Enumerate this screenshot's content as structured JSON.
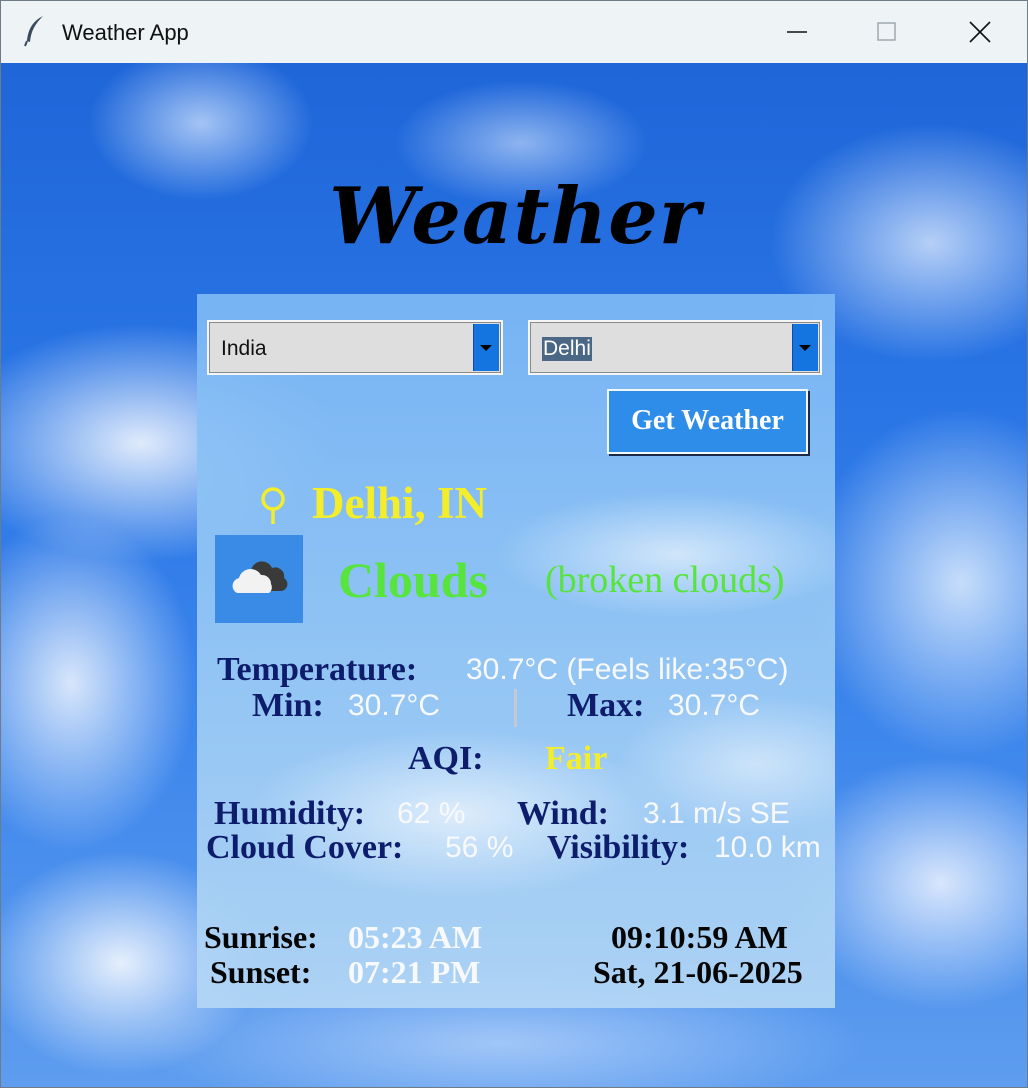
{
  "window": {
    "title": "Weather App"
  },
  "app": {
    "heading": "Weather",
    "country_select": {
      "value": "India"
    },
    "city_select": {
      "value": "Delhi"
    },
    "get_weather_label": "Get Weather",
    "location": "Delhi, IN",
    "weather": {
      "main": "Clouds",
      "description": "(broken clouds)",
      "icon": "broken-clouds-icon"
    },
    "temperature": {
      "label": "Temperature:",
      "value": "30.7°C (Feels like:35°C)"
    },
    "min": {
      "label": "Min:",
      "value": "30.7°C"
    },
    "max": {
      "label": "Max:",
      "value": "30.7°C"
    },
    "aqi": {
      "label": "AQI:",
      "value": "Fair"
    },
    "humidity": {
      "label": "Humidity:",
      "value": "62 %"
    },
    "wind": {
      "label": "Wind:",
      "value": "3.1 m/s SE"
    },
    "cloud_cover": {
      "label": "Cloud Cover:",
      "value": "56 %"
    },
    "visibility": {
      "label": "Visibility:",
      "value": "10.0 km"
    },
    "sunrise": {
      "label": "Sunrise:",
      "value": "05:23 AM"
    },
    "sunset": {
      "label": "Sunset:",
      "value": "07:21 PM"
    },
    "time": "09:10:59 AM",
    "date": "Sat, 21-06-2025"
  },
  "colors": {
    "location_yellow": "#f4ee2a",
    "weather_green": "#56e43d",
    "label_navy": "#0d1c6b",
    "button_blue": "#2e8de8",
    "aqi_yellow": "#f4ee2a"
  }
}
